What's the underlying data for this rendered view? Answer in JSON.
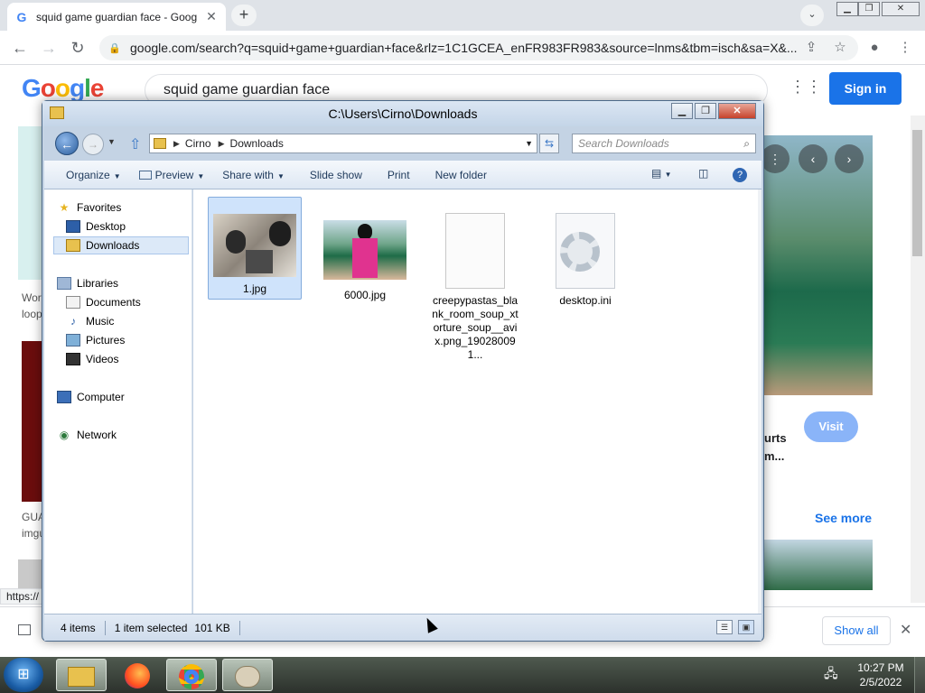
{
  "browser": {
    "tab_title": "squid game guardian face - Google",
    "url": "google.com/search?q=squid+game+guardian+face&rlz=1C1GCEA_enFR983FR983&source=lnms&tbm=isch&sa=X&..."
  },
  "google": {
    "logo": "Google",
    "query": "squid game guardian face",
    "signin_label": "Sign in",
    "left_texts": [
      "Wor",
      "loop",
      "GUA",
      "imgu"
    ],
    "preview_texts": [
      "urts",
      "m..."
    ],
    "visit_label": "Visit",
    "see_more_label": "See more",
    "status_url": "https://",
    "show_all_label": "Show all"
  },
  "explorer": {
    "title": "C:\\Users\\Cirno\\Downloads",
    "breadcrumb": [
      "Cirno",
      "Downloads"
    ],
    "search_placeholder": "Search Downloads",
    "commands": {
      "organize": "Organize",
      "preview": "Preview",
      "share_with": "Share with",
      "slide_show": "Slide show",
      "print": "Print",
      "new_folder": "New folder"
    },
    "nav": {
      "favorites": "Favorites",
      "desktop": "Desktop",
      "downloads": "Downloads",
      "libraries": "Libraries",
      "documents": "Documents",
      "music": "Music",
      "pictures": "Pictures",
      "videos": "Videos",
      "computer": "Computer",
      "network": "Network"
    },
    "files": [
      {
        "name": "1.jpg"
      },
      {
        "name": "6000.jpg"
      },
      {
        "name": "creepypastas_blank_room_soup_xtorture_soup__avix.png_190280091..."
      },
      {
        "name": "desktop.ini"
      }
    ],
    "status": {
      "count": "4 items",
      "selected": "1 item selected",
      "size": "101 KB"
    }
  },
  "taskbar": {
    "time": "10:27 PM",
    "date": "2/5/2022"
  }
}
